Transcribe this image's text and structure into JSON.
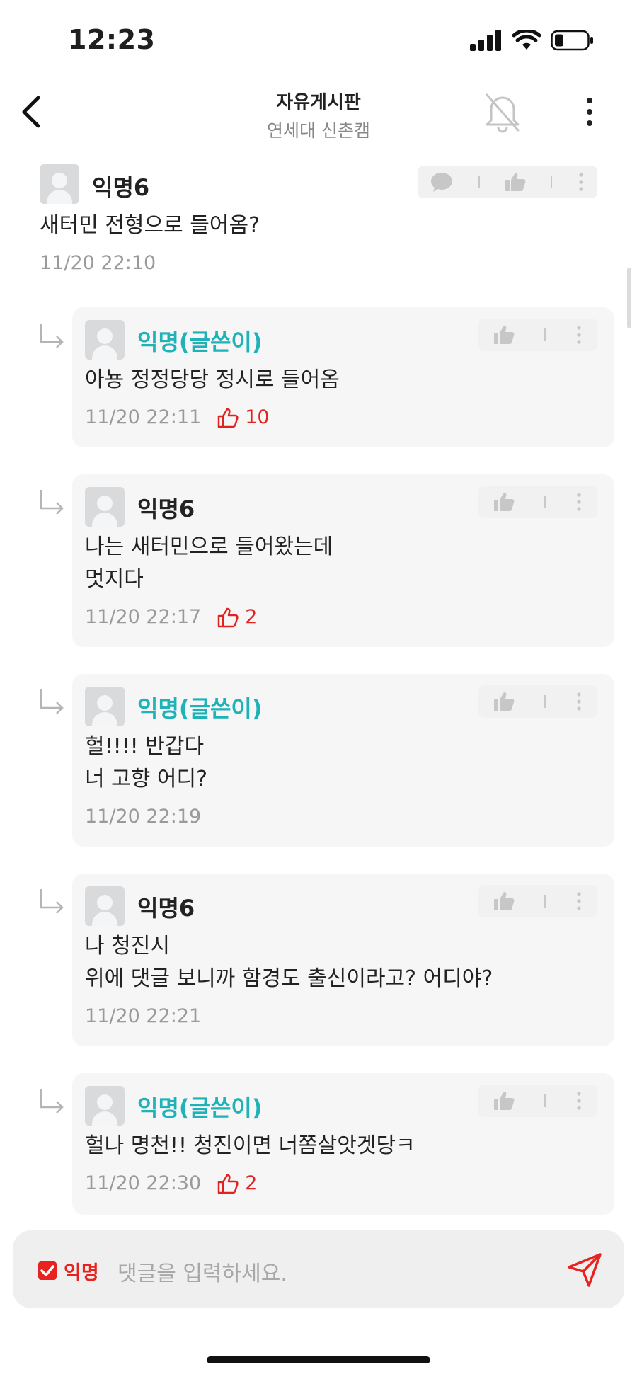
{
  "status_bar": {
    "time": "12:23"
  },
  "header": {
    "title": "자유게시판",
    "subtitle": "연세대 신촌캠"
  },
  "comments": [
    {
      "name": "익명6",
      "text": "새터민 전형으로 들어옴?",
      "time": "11/20 22:10"
    }
  ],
  "replies": [
    {
      "name": "익명(글쓴이)",
      "text": "아뇽 정정당당 정시로 들어옴",
      "time": "11/20 22:11",
      "likes": "10"
    },
    {
      "name": "익명6",
      "text": "나는 새터민으로 들어왔는데\n멋지다",
      "time": "11/20 22:17",
      "likes": "2"
    },
    {
      "name": "익명(글쓴이)",
      "text": "헐!!!! 반갑다\n너 고향 어디?",
      "time": "11/20 22:19",
      "likes": ""
    },
    {
      "name": "익명6",
      "text": "나 청진시\n위에 댓글 보니까 함경도 출신이라고? 어디야?",
      "time": "11/20 22:21",
      "likes": ""
    },
    {
      "name": "익명(글쓴이)",
      "text": "헐나 명천!! 청진이면 너쫌살앗겟당ㅋ",
      "time": "11/20 22:30",
      "likes": "2"
    }
  ],
  "input": {
    "anonymous_label": "익명",
    "placeholder": "댓글을 입력하세요."
  },
  "colors": {
    "op_name": "#1fb2b8",
    "like": "#e0231f",
    "anon": "#e8221e"
  }
}
